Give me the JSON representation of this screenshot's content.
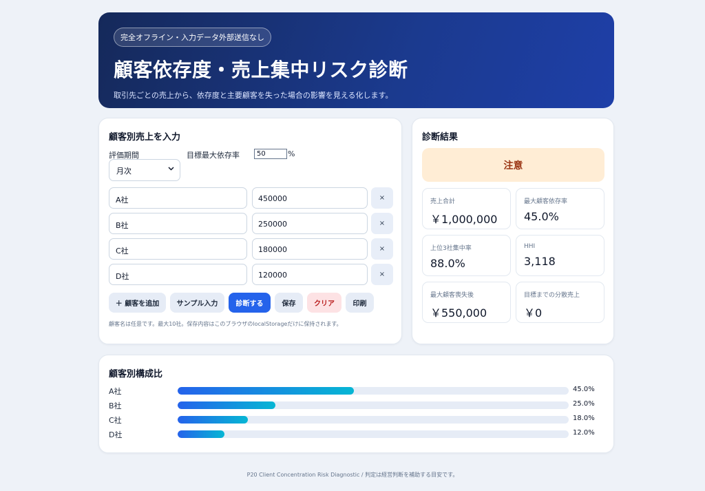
{
  "hero": {
    "badge": "完全オフライン・入力データ外部送信なし",
    "title": "顧客依存度・売上集中リスク診断",
    "subtitle": "取引先ごとの売上から、依存度と主要顧客を失った場合の影響を見える化します。"
  },
  "input_card": {
    "title": "顧客別売上を入力",
    "period_label": "評価期間",
    "period_value": "月次",
    "target_label": "目標最大依存率",
    "target_value": "50",
    "target_unit": "%",
    "rows": [
      {
        "name": "A社",
        "amount": "450000",
        "delete": "×"
      },
      {
        "name": "B社",
        "amount": "250000",
        "delete": "×"
      },
      {
        "name": "C社",
        "amount": "180000",
        "delete": "×"
      },
      {
        "name": "D社",
        "amount": "120000",
        "delete": "×"
      }
    ],
    "buttons": {
      "add": "＋ 顧客を追加",
      "sample": "サンプル入力",
      "diagnose": "診断する",
      "save": "保存",
      "clear": "クリア",
      "print": "印刷"
    },
    "note": "顧客名は任意です。最大10社。保存内容はこのブラウザのlocalStorageだけに保持されます。"
  },
  "result_card": {
    "title": "診断結果",
    "status": "注意",
    "status_color": "#ffedd5",
    "metrics": [
      {
        "label": "売上合計",
        "value": "￥1,000,000"
      },
      {
        "label": "最大顧客依存率",
        "value": "45.0%"
      },
      {
        "label": "上位3社集中率",
        "value": "88.0%"
      },
      {
        "label": "HHI",
        "value": "3,118"
      },
      {
        "label": "最大顧客喪失後",
        "value": "￥550,000"
      },
      {
        "label": "目標までの分散売上",
        "value": "￥0"
      }
    ]
  },
  "composition": {
    "title": "顧客別構成比",
    "items": [
      {
        "name": "A社",
        "percent_label": "45.0%",
        "fraction": 0.45
      },
      {
        "name": "B社",
        "percent_label": "25.0%",
        "fraction": 0.25
      },
      {
        "name": "C社",
        "percent_label": "18.0%",
        "fraction": 0.18
      },
      {
        "name": "D社",
        "percent_label": "12.0%",
        "fraction": 0.12
      }
    ]
  },
  "footer": "P20 Client Concentration Risk Diagnostic / 判定は経営判断を補助する目安です。",
  "colors": {
    "accent": "#2563eb",
    "hero_start": "#15295a",
    "hero_end": "#1e3fa8",
    "bar_start": "#2563eb",
    "bar_end": "#06b6d4"
  }
}
